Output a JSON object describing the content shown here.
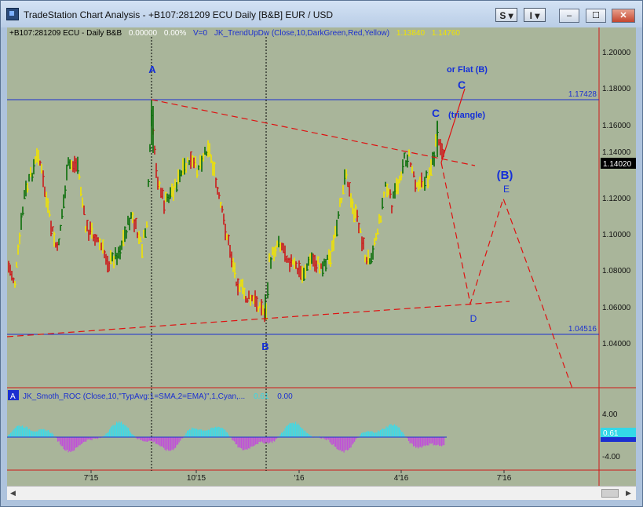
{
  "window": {
    "title": "TradeStation Chart Analysis - +B107:281209 ECU Daily [B&B] EUR / USD",
    "buttons": [
      "S",
      "I"
    ],
    "controls": [
      "–",
      "☐",
      "✕"
    ]
  },
  "price_header": {
    "symbol": "+B107:281209 ECU - Daily  B&B",
    "v1": "0.00000",
    "v2": "0.00%",
    "v3": "V=0",
    "study": "JK_TrendUpDw (Close,10,DarkGreen,Red,Yellow)",
    "val1": "1.13840",
    "val2": "1.14760"
  },
  "osc_header": {
    "badge": "A",
    "study": "JK_Smoth_ROC (Close,10,\"TypAvg:1=SMA,2=EMA)\",1,Cyan,...",
    "val1": "0.61",
    "val2": "0.00"
  },
  "annotations": {
    "A": "A",
    "B": "B",
    "C_top": "C",
    "or_flat": "or Flat (B)",
    "C_mid": "C",
    "triangle": "(triangle)",
    "B_wave": "(B)",
    "E": "E",
    "D": "D"
  },
  "levels": {
    "upper": "1.17428",
    "lower": "1.04516",
    "last": "1.14020",
    "osc_last": "0.61"
  },
  "price_axis": [
    "1.20000",
    "1.18000",
    "1.16000",
    "1.14000",
    "1.12000",
    "1.10000",
    "1.08000",
    "1.06000",
    "1.04000"
  ],
  "osc_axis": [
    "4.00",
    "-4.00"
  ],
  "time_axis": [
    "7'15",
    "10'15",
    "'16",
    "4'16",
    "7'16"
  ],
  "colors": {
    "chart_bg": "#a9b59a",
    "bar_green": "#0a6e0a",
    "bar_red": "#cc1a1a",
    "bar_yellow": "#f0e400",
    "annotation_blue": "#1530d8",
    "trend_red": "#e01010"
  }
}
